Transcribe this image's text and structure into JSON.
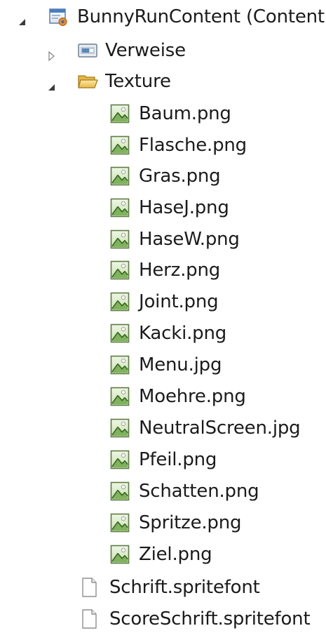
{
  "tree": {
    "root": {
      "label": "BunnyRunContent (Content)",
      "expanded": true,
      "icon": "content-project-icon"
    },
    "references": {
      "label": "Verweise",
      "expanded": false,
      "icon": "references-icon"
    },
    "textures": {
      "label": "Texture",
      "expanded": true,
      "icon": "open-folder-icon",
      "files": [
        {
          "label": "Baum.png",
          "icon": "image-file-icon"
        },
        {
          "label": "Flasche.png",
          "icon": "image-file-icon"
        },
        {
          "label": "Gras.png",
          "icon": "image-file-icon"
        },
        {
          "label": "HaseJ.png",
          "icon": "image-file-icon"
        },
        {
          "label": "HaseW.png",
          "icon": "image-file-icon"
        },
        {
          "label": "Herz.png",
          "icon": "image-file-icon"
        },
        {
          "label": "Joint.png",
          "icon": "image-file-icon"
        },
        {
          "label": "Kacki.png",
          "icon": "image-file-icon"
        },
        {
          "label": "Menu.jpg",
          "icon": "image-file-icon"
        },
        {
          "label": "Moehre.png",
          "icon": "image-file-icon"
        },
        {
          "label": "NeutralScreen.jpg",
          "icon": "image-file-icon"
        },
        {
          "label": "Pfeil.png",
          "icon": "image-file-icon"
        },
        {
          "label": "Schatten.png",
          "icon": "image-file-icon"
        },
        {
          "label": "Spritze.png",
          "icon": "image-file-icon"
        },
        {
          "label": "Ziel.png",
          "icon": "image-file-icon"
        }
      ]
    },
    "fonts": [
      {
        "label": "Schrift.spritefont",
        "icon": "blank-file-icon"
      },
      {
        "label": "ScoreSchrift.spritefont",
        "icon": "blank-file-icon"
      }
    ]
  }
}
